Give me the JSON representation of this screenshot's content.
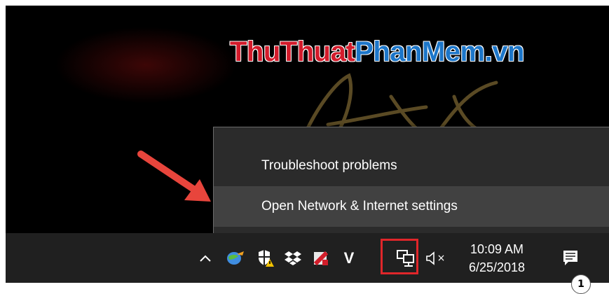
{
  "watermark": {
    "part1": "ThuThuat",
    "part2": "PhanMem",
    "part3": ".vn"
  },
  "context_menu": {
    "items": [
      {
        "label": "Troubleshoot problems"
      },
      {
        "label": "Open Network & Internet settings"
      }
    ]
  },
  "taskbar": {
    "clock": {
      "time": "10:09 AM",
      "date": "6/25/2018"
    },
    "tray_icons": [
      "show-hidden-icons-icon",
      "network-globe-icon",
      "shield-warning-icon",
      "dropbox-icon",
      "antivirus-icon",
      "v-app-icon",
      "network-icon",
      "volume-muted-icon"
    ],
    "v_letter": "V",
    "mute_symbol": "×",
    "notification_count": "1"
  },
  "colors": {
    "highlight": "#e0262a",
    "arrow": "#e8453c",
    "menu_bg": "#2b2b2b",
    "hover_bg": "#414141",
    "taskbar_bg": "#202020"
  }
}
